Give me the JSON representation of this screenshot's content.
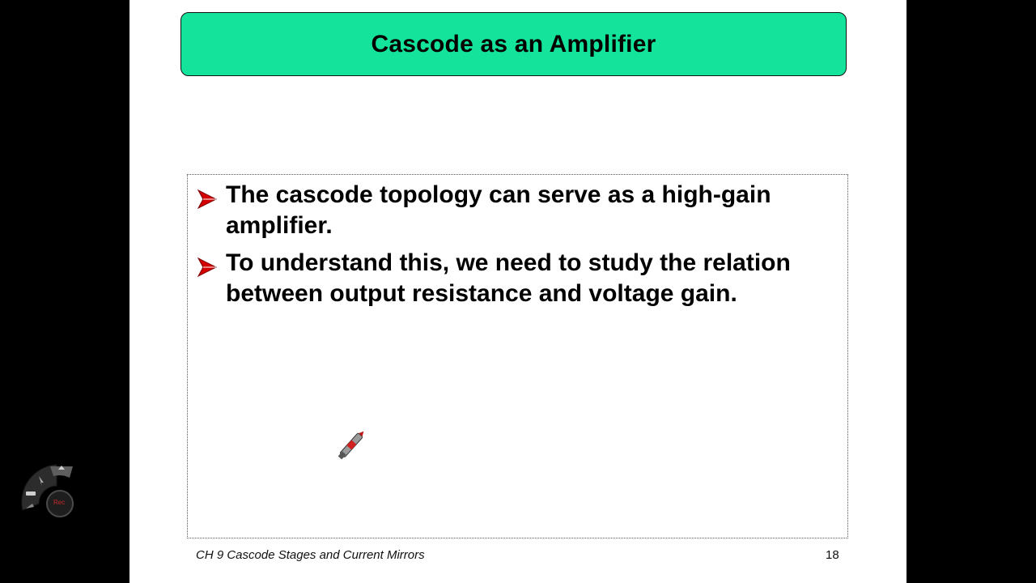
{
  "slide": {
    "title": "Cascode as an Amplifier",
    "bullets": [
      {
        "text": "The cascode topology can serve as a high-gain amplifier."
      },
      {
        "text": "To understand this, we need to study the relation between output resistance and voltage gain."
      }
    ],
    "footer": {
      "chapter": "CH 9  Cascode Stages and Current Mirrors",
      "page_number": "18"
    }
  },
  "recorder": {
    "rec_label": "Rec"
  },
  "colors": {
    "title_bg": "#14e39b",
    "bullet_arrow": "#d40000",
    "outer_bg": "#000000"
  },
  "icons": {
    "bullet": "arrowhead-bullet-icon",
    "cursor": "pen-cursor-icon",
    "recorder": "recording-toolbar-icon"
  }
}
